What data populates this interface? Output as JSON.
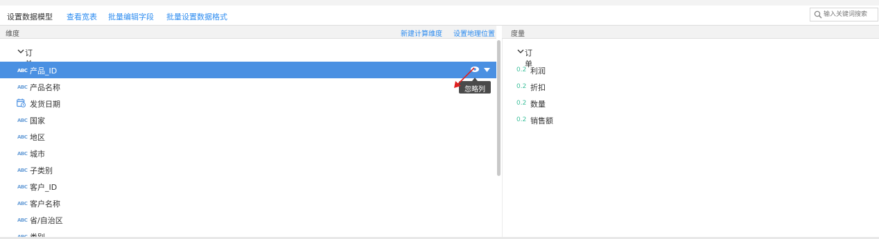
{
  "toolbar": {
    "title": "设置数据模型",
    "links": [
      "查看宽表",
      "批量编辑字段",
      "批量设置数据格式"
    ],
    "search_placeholder": "输入关键词搜索",
    "search_value": ""
  },
  "dimensions": {
    "header": "维度",
    "actions": [
      "新建计算维度",
      "设置地理位置"
    ],
    "group": "订单",
    "fields": [
      {
        "type": "ABC",
        "name": "产品_ID",
        "selected": true
      },
      {
        "type": "ABC",
        "name": "产品名称"
      },
      {
        "type": "date",
        "name": "发货日期"
      },
      {
        "type": "ABC",
        "name": "国家"
      },
      {
        "type": "ABC",
        "name": "地区"
      },
      {
        "type": "ABC",
        "name": "城市"
      },
      {
        "type": "ABC",
        "name": "子类别"
      },
      {
        "type": "ABC",
        "name": "客户_ID"
      },
      {
        "type": "ABC",
        "name": "客户名称"
      },
      {
        "type": "ABC",
        "name": "省/自治区"
      },
      {
        "type": "ABC",
        "name": "类别"
      }
    ],
    "tooltip": "忽略列"
  },
  "measures": {
    "header": "度量",
    "group": "订单",
    "fields": [
      {
        "type": "0.2",
        "name": "利润"
      },
      {
        "type": "0.2",
        "name": "折扣"
      },
      {
        "type": "0.2",
        "name": "数量"
      },
      {
        "type": "0.2",
        "name": "销售额"
      }
    ]
  },
  "colors": {
    "accent": "#2d8cf0",
    "selected_row": "#4a90e2",
    "measure_icon": "#3bbf9a"
  }
}
